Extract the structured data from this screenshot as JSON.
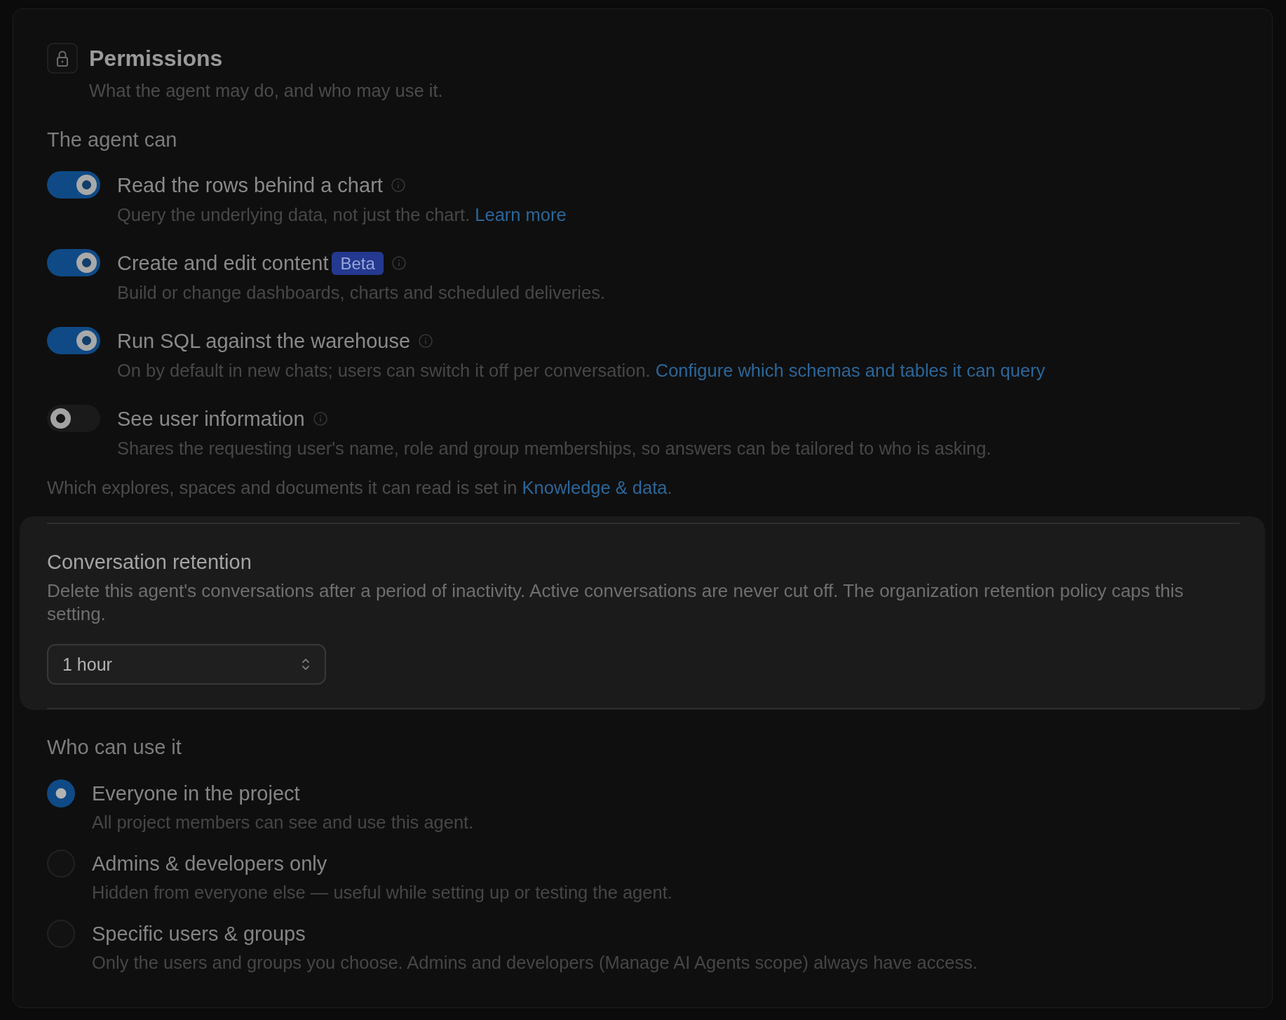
{
  "header": {
    "title": "Permissions",
    "subtitle": "What the agent may do, and who may use it."
  },
  "capabilities": {
    "heading": "The agent can",
    "items": [
      {
        "title": "Read the rows behind a chart",
        "on": true,
        "description": "Query the underlying data, not just the chart.",
        "link": "Learn more"
      },
      {
        "title": "Create and edit content",
        "badge": "Beta",
        "on": true,
        "description": "Build or change dashboards, charts and scheduled deliveries."
      },
      {
        "title": "Run SQL against the warehouse",
        "on": true,
        "description": "On by default in new chats; users can switch it off per conversation.",
        "link": "Configure which schemas and tables it can query"
      },
      {
        "title": "See user information",
        "on": false,
        "description": "Shares the requesting user's name, role and group memberships, so answers can be tailored to who is asking."
      }
    ],
    "footnote": {
      "text": "Which explores, spaces and documents it can read is set in",
      "link": "Knowledge & data",
      "end": "."
    }
  },
  "retention": {
    "highlighted": true,
    "title": "Conversation retention",
    "description": "Delete this agent's conversations after a period of inactivity. Active conversations are never cut off. The organization retention policy caps this setting.",
    "select": {
      "value": "1 hour"
    }
  },
  "access": {
    "heading": "Who can use it",
    "options": [
      {
        "label": "Everyone in the project",
        "description": "All project members can see and use this agent.",
        "selected": true
      },
      {
        "label": "Admins & developers only",
        "description": "Hidden from everyone else — useful while setting up or testing the agent.",
        "selected": false
      },
      {
        "label": "Specific users & groups",
        "description": "Only the users and groups you choose. Admins and developers (Manage AI Agents scope) always have access.",
        "selected": false
      }
    ]
  }
}
